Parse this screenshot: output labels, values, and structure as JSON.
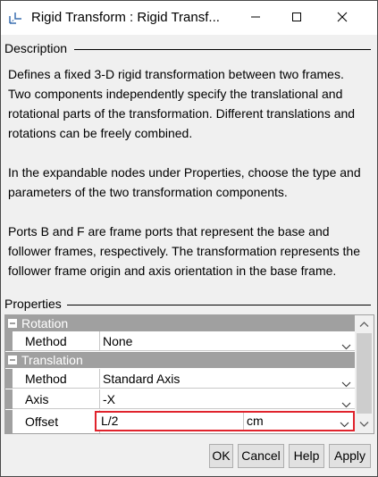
{
  "window": {
    "title": "Rigid Transform : Rigid Transf..."
  },
  "description": {
    "heading": "Description",
    "paragraphs": [
      "Defines a fixed 3-D rigid transformation between two frames. Two components independently specify the translational and rotational parts of the transformation. Different translations and rotations can be freely combined.",
      "In the expandable nodes under Properties, choose the type and parameters of the two transformation components.",
      "Ports B and F are frame ports that represent the base and follower frames, respectively. The transformation represents the follower frame origin and axis orientation in the base frame."
    ]
  },
  "properties": {
    "heading": "Properties",
    "rotation": {
      "header": "Rotation",
      "method_label": "Method",
      "method_value": "None"
    },
    "translation": {
      "header": "Translation",
      "method_label": "Method",
      "method_value": "Standard Axis",
      "axis_label": "Axis",
      "axis_value": "-X",
      "offset_label": "Offset",
      "offset_value": "L/2",
      "offset_unit": "cm"
    }
  },
  "buttons": {
    "ok": "OK",
    "cancel": "Cancel",
    "help": "Help",
    "apply": "Apply"
  },
  "colors": {
    "highlight_border": "#e0232c",
    "section_header": "#a0a0a0"
  }
}
